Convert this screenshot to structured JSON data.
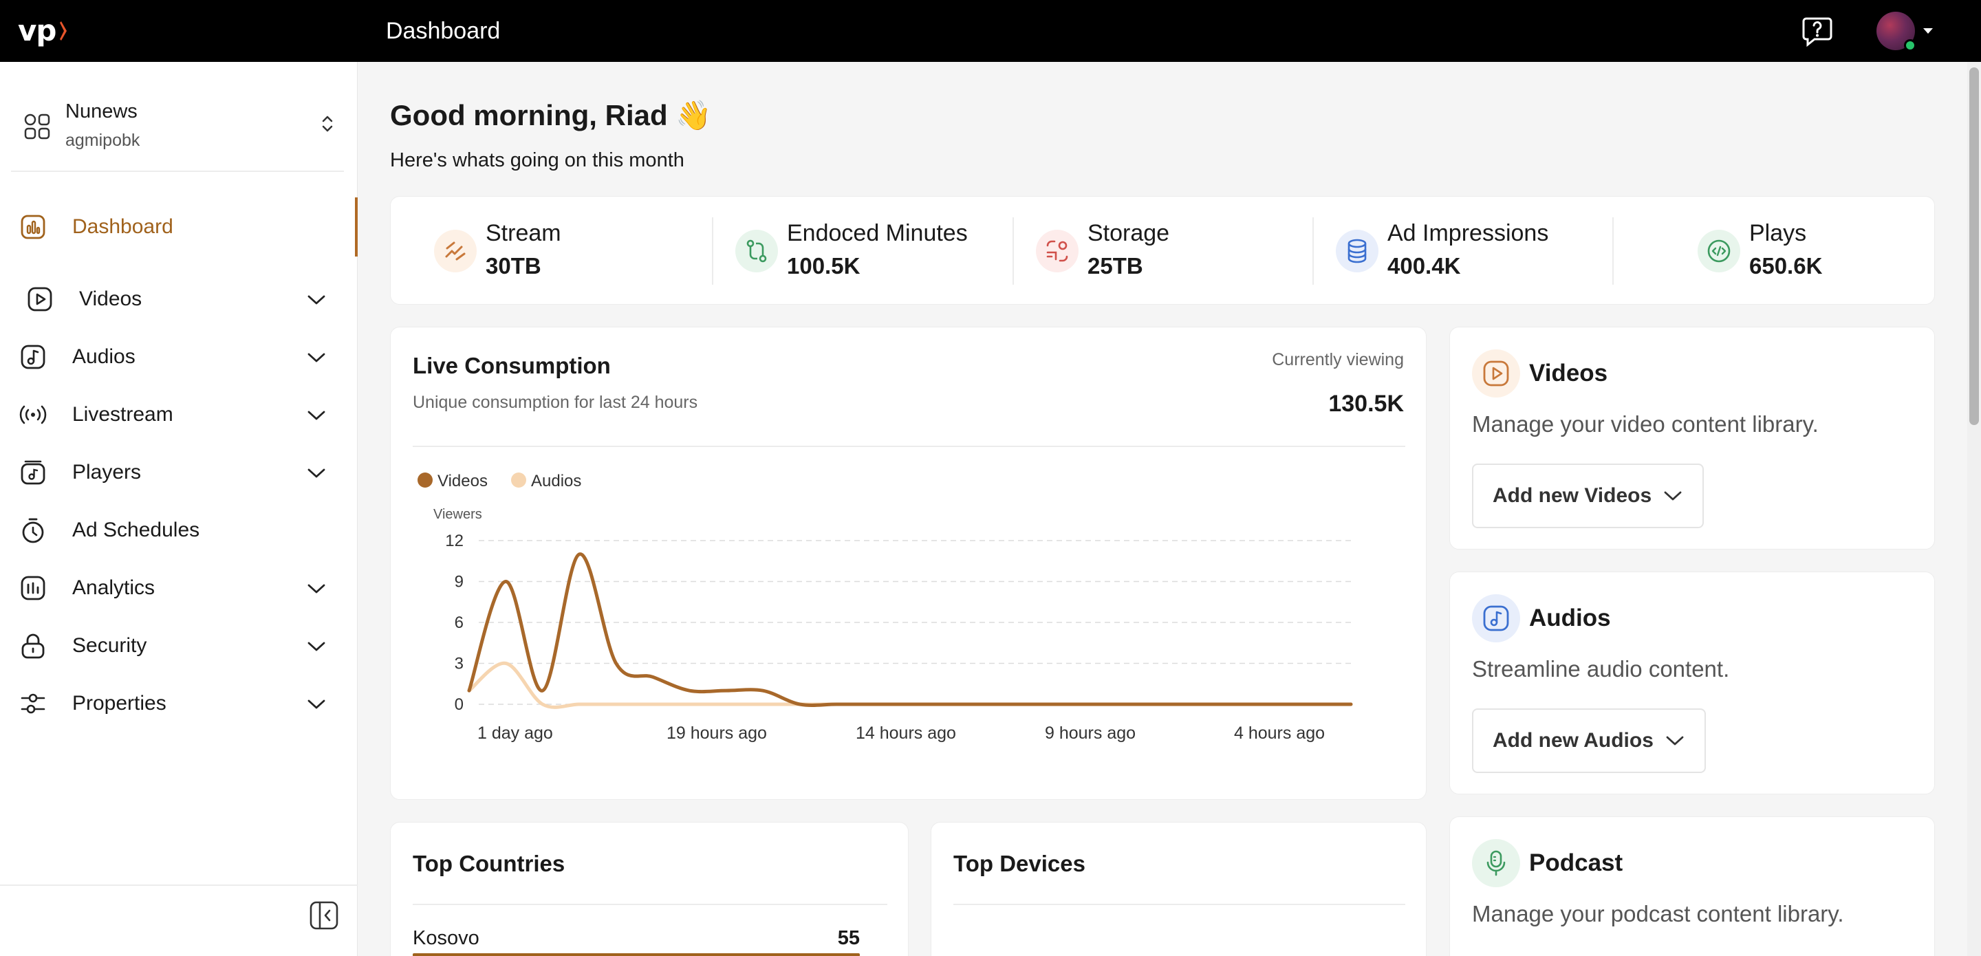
{
  "topbar": {
    "logo_text": "vp",
    "title": "Dashboard",
    "help_icon": "help-chat-icon",
    "avatar_status_color": "#27c46a"
  },
  "sidebar": {
    "org_name": "Nunews",
    "org_sub": "agmipobk",
    "items": [
      {
        "label": "Dashboard",
        "icon": "dashboard-icon",
        "active": true,
        "expandable": false
      },
      {
        "label": "Videos",
        "icon": "video-icon",
        "active": false,
        "expandable": true
      },
      {
        "label": "Audios",
        "icon": "audio-icon",
        "active": false,
        "expandable": true
      },
      {
        "label": "Livestream",
        "icon": "livestream-icon",
        "active": false,
        "expandable": true
      },
      {
        "label": "Players",
        "icon": "player-icon",
        "active": false,
        "expandable": true
      },
      {
        "label": "Ad Schedules",
        "icon": "timer-icon",
        "active": false,
        "expandable": false
      },
      {
        "label": "Analytics",
        "icon": "analytics-icon",
        "active": false,
        "expandable": true
      },
      {
        "label": "Security",
        "icon": "lock-icon",
        "active": false,
        "expandable": true
      },
      {
        "label": "Properties",
        "icon": "sliders-icon",
        "active": false,
        "expandable": true
      }
    ]
  },
  "main": {
    "greeting": "Good morning, Riad 👋",
    "subgreeting": "Here's whats going on this month",
    "stats": [
      {
        "label": "Stream",
        "value": "30TB",
        "icon": "stream-icon",
        "color": "#c8783a"
      },
      {
        "label": "Endoced Minutes",
        "value": "100.5K",
        "icon": "git-compare-icon",
        "color": "#3c9a5f"
      },
      {
        "label": "Storage",
        "value": "25TB",
        "icon": "storage-icon",
        "color": "#d0504a"
      },
      {
        "label": "Ad Impressions",
        "value": "400.4K",
        "icon": "database-icon",
        "color": "#3a6fd0"
      },
      {
        "label": "Plays",
        "value": "650.6K",
        "icon": "code-icon",
        "color": "#3c9a5f"
      }
    ],
    "live": {
      "title": "Live Consumption",
      "subtitle": "Unique consumption for last 24 hours",
      "currently_viewing_label": "Currently viewing",
      "currently_viewing_value": "130.5K"
    },
    "side_cards": [
      {
        "title": "Videos",
        "desc": "Manage your video content library.",
        "button": "Add new Videos",
        "icon": "video-icon",
        "color": "#c8783a"
      },
      {
        "title": "Audios",
        "desc": "Streamline audio content.",
        "button": "Add new Audios",
        "icon": "audio-icon",
        "color": "#3a6fd0"
      },
      {
        "title": "Podcast",
        "desc": "Manage your podcast content library.",
        "button": "",
        "icon": "microphone-icon",
        "color": "#3c9a5f"
      }
    ],
    "top_countries": {
      "title": "Top Countries",
      "rows": [
        {
          "name": "Kosovo",
          "value": "55",
          "fraction": 1.0
        }
      ]
    },
    "top_devices": {
      "title": "Top Devices"
    }
  },
  "chart_data": {
    "type": "line",
    "ylabel": "Viewers",
    "xlabel": "",
    "ylim": [
      0,
      12
    ],
    "yticks": [
      "0",
      "3",
      "6",
      "9",
      "12"
    ],
    "x_ticks": [
      "1 day ago",
      "19 hours ago",
      "14 hours ago",
      "9 hours ago",
      "4 hours ago"
    ],
    "legend_position": "top-left",
    "grid": true,
    "series": [
      {
        "name": "Videos",
        "color": "#a8682a",
        "values": [
          1,
          9,
          1,
          11,
          3,
          2,
          1,
          1,
          1,
          0,
          0,
          0,
          0,
          0,
          0,
          0,
          0,
          0,
          0,
          0,
          0,
          0,
          0,
          0,
          0
        ]
      },
      {
        "name": "Audios",
        "color": "#f6d5b0",
        "values": [
          1,
          3,
          0,
          0,
          0,
          0,
          0,
          0,
          0,
          0,
          0,
          0,
          0,
          0,
          0,
          0,
          0,
          0,
          0,
          0,
          0,
          0,
          0,
          0,
          0
        ]
      }
    ]
  }
}
